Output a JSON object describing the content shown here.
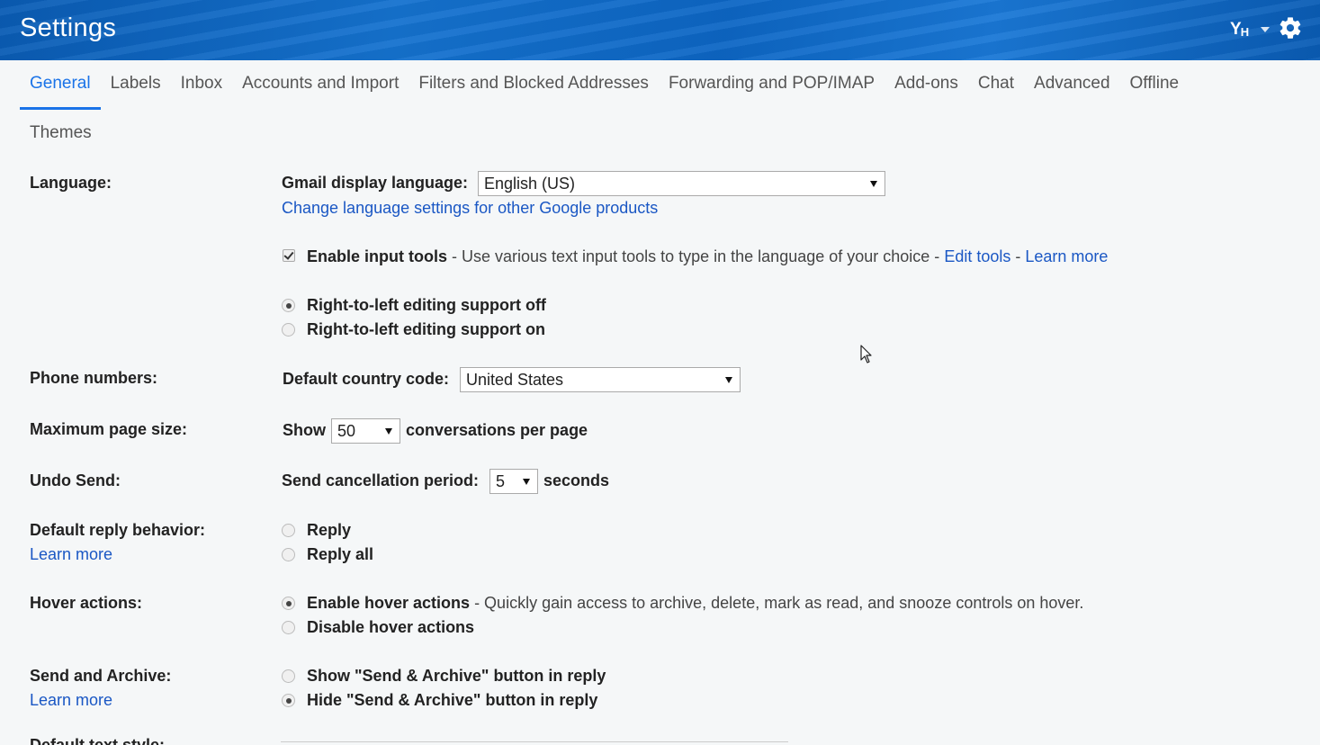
{
  "header": {
    "title": "Settings",
    "input_tools_main": "Y",
    "input_tools_sub": "H",
    "icons": [
      "input-tools-icon",
      "chevron-down-icon",
      "gear-icon"
    ]
  },
  "tabs": [
    {
      "label": "General",
      "active": true
    },
    {
      "label": "Labels"
    },
    {
      "label": "Inbox"
    },
    {
      "label": "Accounts and Import"
    },
    {
      "label": "Filters and Blocked Addresses"
    },
    {
      "label": "Forwarding and POP/IMAP"
    },
    {
      "label": "Add-ons"
    },
    {
      "label": "Chat"
    },
    {
      "label": "Advanced"
    },
    {
      "label": "Offline"
    }
  ],
  "tab_second_row": "Themes",
  "language": {
    "label": "Language:",
    "display_label": "Gmail display language:",
    "display_value": "English (US)",
    "change_link": "Change language settings for other Google products",
    "input_tools_label": "Enable input tools",
    "input_tools_desc": " - Use various text input tools to type in the language of your choice - ",
    "edit_tools_link": "Edit tools",
    "dash": " - ",
    "learn_more_link": "Learn more",
    "input_tools_checked": true,
    "rtl_off": "Right-to-left editing support off",
    "rtl_on": "Right-to-left editing support on",
    "rtl_selected": "off"
  },
  "phone": {
    "label": "Phone numbers:",
    "country_label": "Default country code:",
    "country_value": "United States"
  },
  "page_size": {
    "label": "Maximum page size:",
    "show": "Show",
    "value": "50",
    "suffix": "conversations per page"
  },
  "undo_send": {
    "label": "Undo Send:",
    "period_label": "Send cancellation period:",
    "value": "5",
    "suffix": "seconds"
  },
  "reply": {
    "label": "Default reply behavior:",
    "learn_more": "Learn more",
    "reply": "Reply",
    "reply_all": "Reply all"
  },
  "hover": {
    "label": "Hover actions:",
    "enable": "Enable hover actions",
    "enable_desc": " - Quickly gain access to archive, delete, mark as read, and snooze controls on hover.",
    "disable": "Disable hover actions",
    "selected": "enable"
  },
  "send_archive": {
    "label": "Send and Archive:",
    "learn_more": "Learn more",
    "show": "Show \"Send & Archive\" button in reply",
    "hide": "Hide \"Send & Archive\" button in reply",
    "selected": "hide"
  },
  "partial": {
    "label": "Default text style:"
  },
  "colors": {
    "header_blue": "#0d66c4",
    "tab_active": "#1a73e8",
    "link": "#1a57c4"
  }
}
